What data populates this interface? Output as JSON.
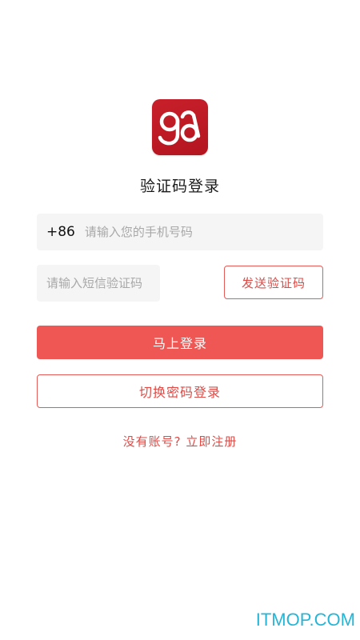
{
  "app": {
    "logo_text": "ga",
    "brand_color": "#c8202b",
    "accent_color": "#ee5753"
  },
  "header": {
    "title": "验证码登录"
  },
  "phone_field": {
    "country_code": "+86",
    "placeholder": "请输入您的手机号码",
    "value": ""
  },
  "code_field": {
    "placeholder": "请输入短信验证码",
    "value": ""
  },
  "buttons": {
    "send_code": "发送验证码",
    "login": "马上登录",
    "switch_password": "切换密码登录"
  },
  "links": {
    "register": "没有账号? 立即注册"
  },
  "watermark": {
    "text": "ITMOP.COM",
    "color": "#27b5d6"
  }
}
